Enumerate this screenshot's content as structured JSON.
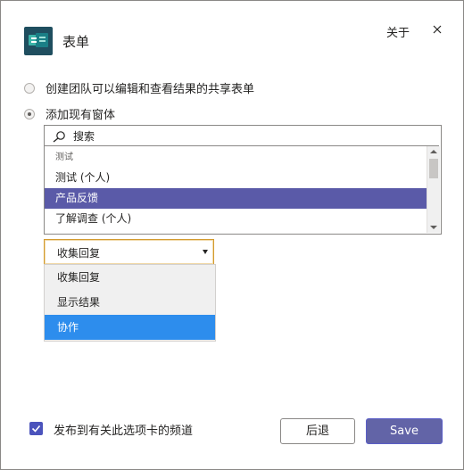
{
  "dialog": {
    "title": "表单",
    "about_label": "关于"
  },
  "options": {
    "create_shared": "创建团队可以编辑和查看结果的共享表单",
    "add_existing": "添加现有窗体"
  },
  "search": {
    "value": "搜索"
  },
  "form_list": {
    "group_label": "测试",
    "items": [
      "测试 (个人)",
      "产品反馈",
      "了解调查 (个人)"
    ],
    "selected": "产品反馈"
  },
  "mode_select": {
    "value": "收集回复",
    "options": [
      "收集回复",
      "显示结果",
      "协作"
    ],
    "highlighted": "协作"
  },
  "footer": {
    "post_to_channel": "发布到有关此选项卡的频道",
    "back_label": "后退",
    "save_label": "Save"
  },
  "colors": {
    "accent": "#6264a7",
    "selection": "#5a5aa8",
    "highlight": "#2d8ded"
  }
}
